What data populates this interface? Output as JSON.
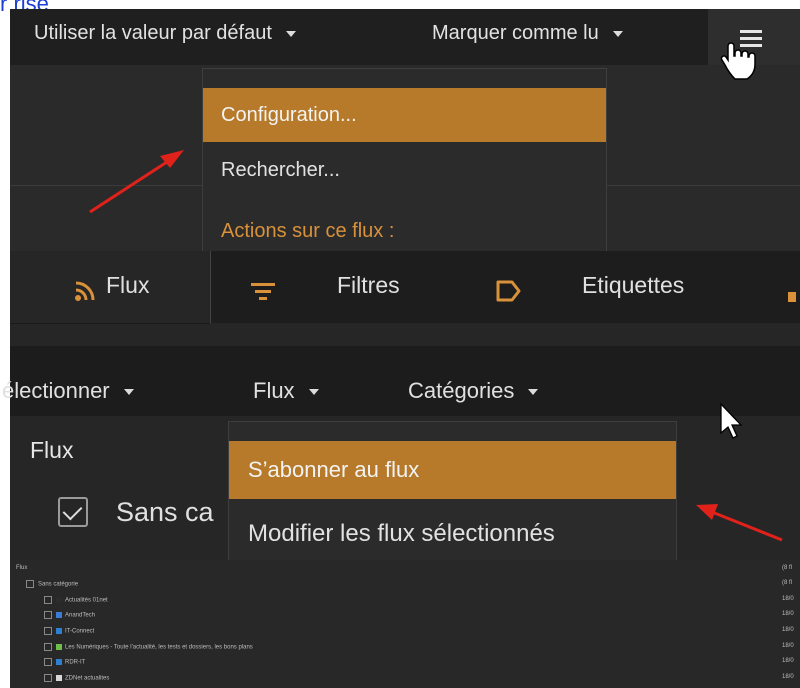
{
  "top_link": {
    "text": "r rise"
  },
  "panel1": {
    "default_button": "Utiliser la valeur par défaut",
    "mark_read_button": "Marquer comme lu",
    "menu_items": [
      "Configuration...",
      "Rechercher..."
    ],
    "section_label": "Actions sur ce flux :"
  },
  "panel2": {
    "tabs": [
      "Flux",
      "Filtres",
      "Etiquettes"
    ]
  },
  "panel3": {
    "buttons": [
      "électionner",
      "Flux",
      "Catégories"
    ],
    "menu_items": [
      "S’abonner au flux",
      "Modifier les flux sélectionnés"
    ],
    "heading": "Flux",
    "category_label": "Sans ca"
  },
  "panel4": {
    "tree": [
      {
        "label": "Flux",
        "right": "(8 fl"
      },
      {
        "label": "Sans catégorie",
        "right": "(8 fl"
      },
      {
        "label": "Actualités 01net",
        "right": "18/0"
      },
      {
        "label": "AnandTech",
        "right": "18/0"
      },
      {
        "label": "IT-Connect",
        "right": "18/0"
      },
      {
        "label": "Les Numériques - Toute l'actualité, les tests et dossiers, les bons plans",
        "right": "18/0"
      },
      {
        "label": "RDR-IT",
        "right": "18/0"
      },
      {
        "label": "ZDNet actualites",
        "right": "18/0"
      }
    ]
  },
  "colors": {
    "accent": "#b77a2a",
    "gold_text": "#d9913a",
    "dark_bg": "#262626",
    "arrow": "#e0221b"
  },
  "icons": [
    "hamburger-menu-icon",
    "hand-cursor-icon",
    "arrow-cursor-icon",
    "rss-icon",
    "filter-icon",
    "tag-icon",
    "checkbox-icon"
  ]
}
